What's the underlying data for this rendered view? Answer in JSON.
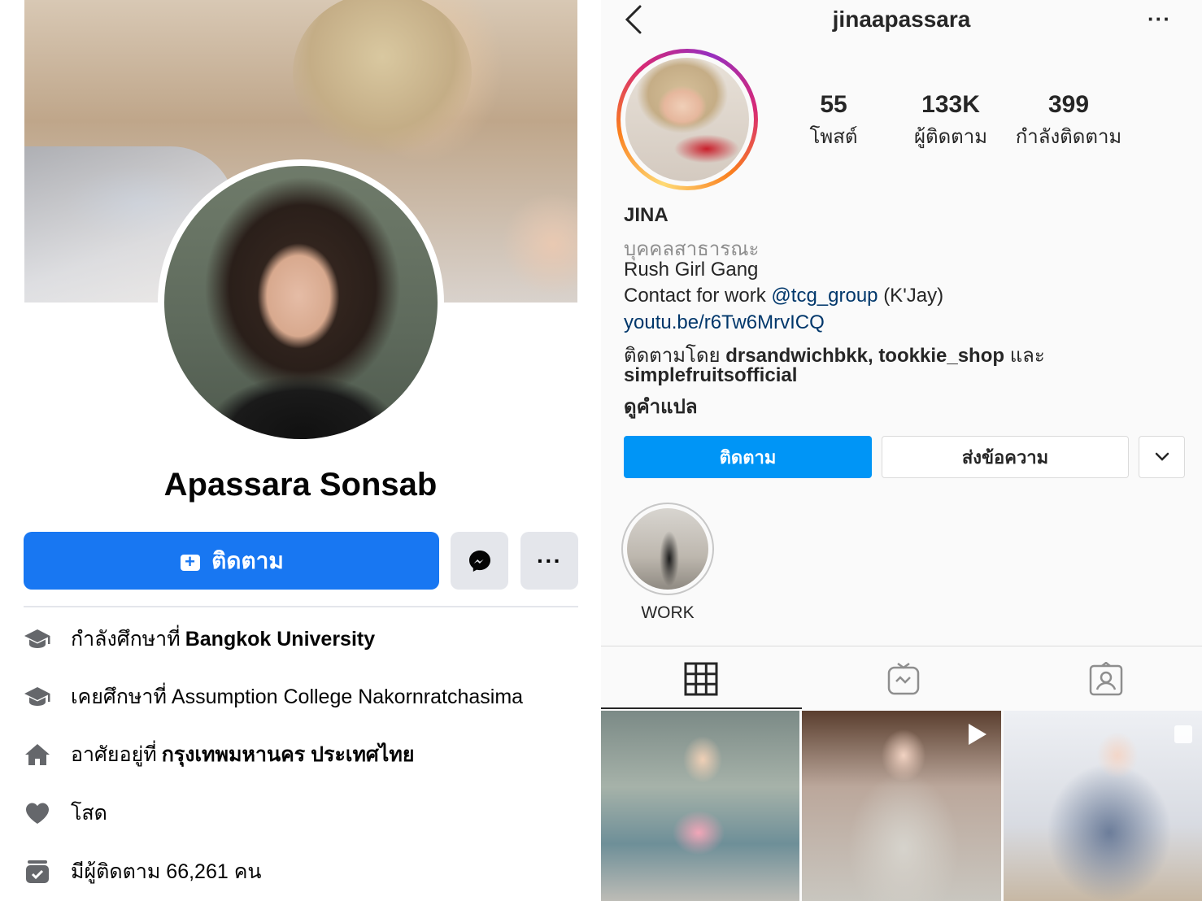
{
  "facebook": {
    "name": "Apassara Sonsab",
    "follow_label": "ติดตาม",
    "more_label": "···",
    "info": [
      {
        "icon": "graduation-cap-icon",
        "prefix": "กำลังศึกษาที่",
        "value": "Bangkok University",
        "bold": true
      },
      {
        "icon": "graduation-cap-icon",
        "prefix": "เคยศึกษาที่",
        "value": "Assumption College Nakornratchasima",
        "bold": false
      },
      {
        "icon": "home-icon",
        "prefix": "อาศัยอยู่ที่",
        "value": "กรุงเทพมหานคร ประเทศไทย",
        "bold": true
      },
      {
        "icon": "heart-icon",
        "prefix": "โสด",
        "value": "",
        "bold": false
      },
      {
        "icon": "followers-icon",
        "prefix": "มีผู้ติดตาม 66,261 คน",
        "value": "",
        "bold": false
      }
    ],
    "accent": "#1877f2"
  },
  "instagram": {
    "username": "jinaapassara",
    "more_label": "···",
    "stats": [
      {
        "value": "55",
        "label": "โพสต์"
      },
      {
        "value": "133K",
        "label": "ผู้ติดตาม"
      },
      {
        "value": "399",
        "label": "กำลังติดตาม"
      }
    ],
    "display_name": "JINA",
    "category": "บุคคลสาธารณะ",
    "bio_line1": "Rush Girl Gang",
    "bio_contact_prefix": "Contact for work",
    "bio_contact_handle": "@tcg_group",
    "bio_contact_suffix": "(K'Jay)",
    "bio_link": "youtu.be/r6Tw6MrvICQ",
    "followed_by_prefix": "ติดตามโดย",
    "followed_by_names": "drsandwichbkk, tookkie_shop",
    "followed_by_and": "และ",
    "followed_by_last": "simplefruitsofficial",
    "translate_label": "ดูคำแปล",
    "follow_label": "ติดตาม",
    "message_label": "ส่งข้อความ",
    "highlight_label": "WORK",
    "accent": "#0095f6"
  }
}
